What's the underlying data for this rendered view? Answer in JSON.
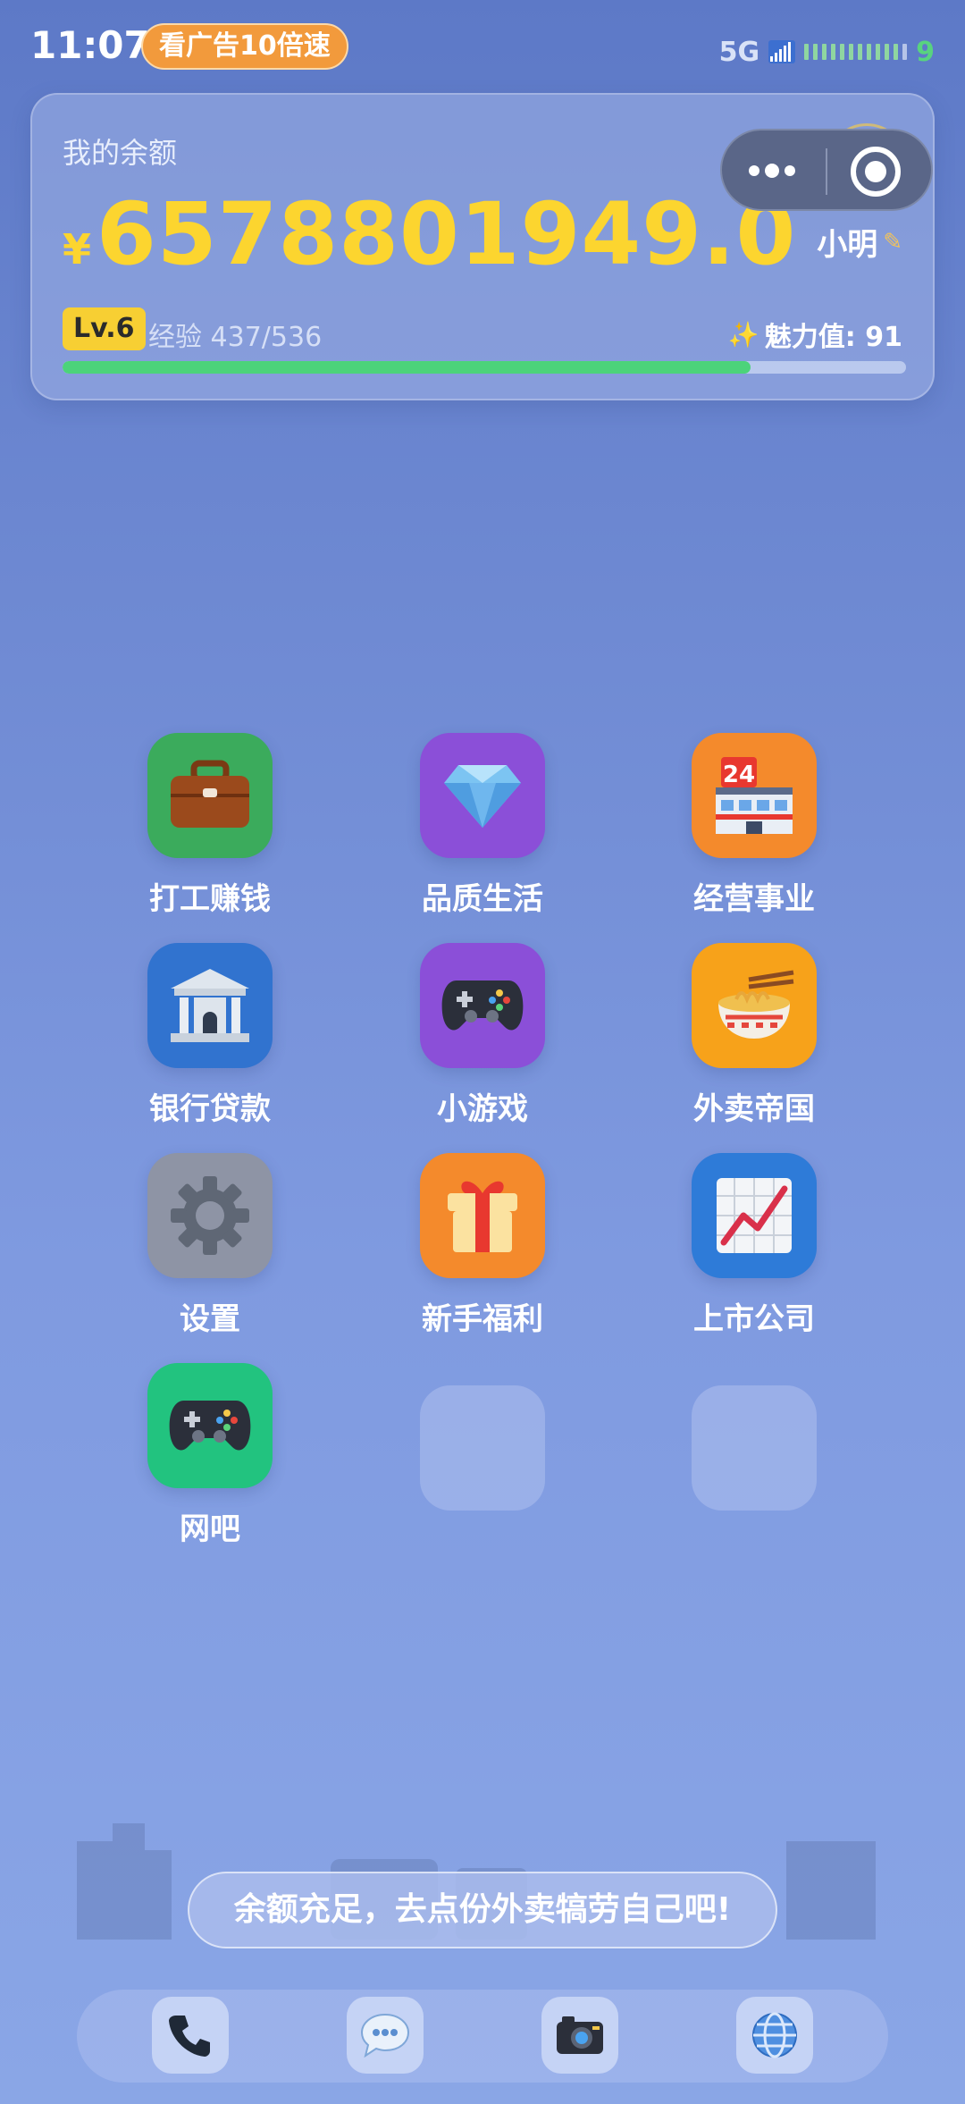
{
  "status": {
    "time": "11:07",
    "ad_badge": "看广告10倍速",
    "network": "5G",
    "battery_level": "9",
    "battery_fraction": 0.9
  },
  "balance": {
    "label": "我的余额",
    "currency": "¥",
    "amount": "6578801949.0",
    "user_name": "小明",
    "level": "Lv.6",
    "exp_text": "经验 437/536",
    "exp_current": 437,
    "exp_max": 536,
    "charm_text": "魅力值: 91"
  },
  "apps": [
    {
      "label": "打工赚钱",
      "icon": "briefcase-icon",
      "color": "#3bab5c"
    },
    {
      "label": "品质生活",
      "icon": "diamond-icon",
      "color": "#8b4fd8"
    },
    {
      "label": "经营事业",
      "icon": "store-24-icon",
      "color": "#f48a2c"
    },
    {
      "label": "银行贷款",
      "icon": "bank-icon",
      "color": "#3173cf"
    },
    {
      "label": "小游戏",
      "icon": "gamepad-icon",
      "color": "#8b4fd8"
    },
    {
      "label": "外卖帝国",
      "icon": "noodle-bowl-icon",
      "color": "#f7a21a"
    },
    {
      "label": "设置",
      "icon": "gear-icon",
      "color": "#8e94a5"
    },
    {
      "label": "新手福利",
      "icon": "gift-icon",
      "color": "#f48a2c"
    },
    {
      "label": "上市公司",
      "icon": "stock-chart-icon",
      "color": "#2e7bd8"
    },
    {
      "label": "网吧",
      "icon": "gamepad-icon",
      "color": "#22c37f"
    }
  ],
  "toast": "余额充足，去点份外卖犒劳自己吧!",
  "dock": [
    {
      "icon": "phone-icon"
    },
    {
      "icon": "chat-icon"
    },
    {
      "icon": "camera-icon"
    },
    {
      "icon": "globe-icon"
    }
  ],
  "colors": {
    "amount": "#fcd52f",
    "exp_fill": "#4cd37a",
    "level_badge": "#f7cf33",
    "ad_badge": "#f29a3c"
  }
}
